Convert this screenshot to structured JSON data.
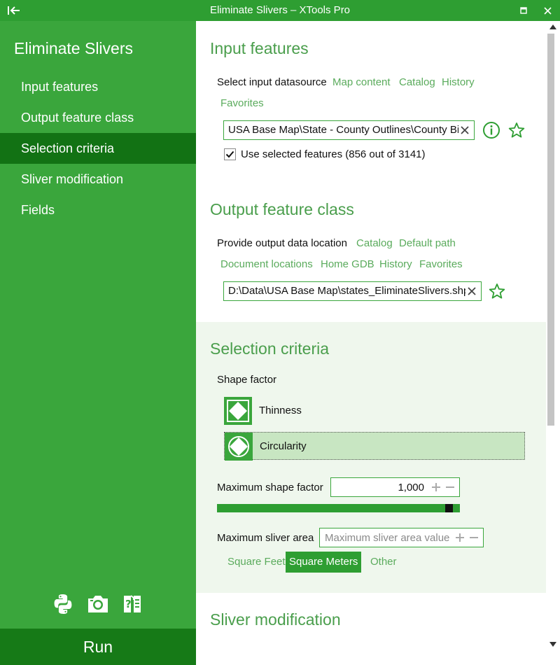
{
  "window": {
    "title": "Eliminate Slivers – XTools Pro",
    "back_icon": "collapse-left-icon",
    "maximize_icon": "maximize-icon",
    "close_icon": "close-icon"
  },
  "colors": {
    "accent": "#2e9e32",
    "sidebar_bg": "#3aa63c",
    "sidebar_active": "#127214",
    "link": "#5aab5c",
    "section_title": "#4a9e4c",
    "selection_band": "#eff7ed",
    "selected_option": "#c8e6c2"
  },
  "sidebar": {
    "title": "Eliminate Slivers",
    "items": [
      {
        "label": "Input features",
        "active": false
      },
      {
        "label": "Output feature class",
        "active": false
      },
      {
        "label": "Selection criteria",
        "active": true
      },
      {
        "label": "Sliver modification",
        "active": false
      },
      {
        "label": "Fields",
        "active": false
      }
    ],
    "tool_icons": [
      "python-icon",
      "camera-icon",
      "help-document-icon"
    ],
    "run_label": "Run"
  },
  "input_features": {
    "title": "Input features",
    "datasource_label": "Select input datasource",
    "links": [
      "Map content",
      "Catalog",
      "History",
      "Favorites"
    ],
    "path_value": "USA Base Map\\State - County Outlines\\County Bi",
    "use_selected_label": "Use selected features (856 out of 3141)",
    "use_selected_checked": true
  },
  "output_feature_class": {
    "title": "Output feature class",
    "location_label": "Provide output data location",
    "links": [
      "Catalog",
      "Default path",
      "Document locations",
      "Home GDB",
      "History",
      "Favorites"
    ],
    "path_value": "D:\\Data\\USA Base Map\\states_EliminateSlivers.shp"
  },
  "selection_criteria": {
    "title": "Selection criteria",
    "shape_factor_label": "Shape factor",
    "options": [
      {
        "label": "Thinness",
        "icon": "thinness-diamond-icon",
        "selected": false
      },
      {
        "label": "Circularity",
        "icon": "circularity-icon",
        "selected": true
      }
    ],
    "max_shape_factor_label": "Maximum shape factor",
    "max_shape_factor_value": "1,000",
    "max_shape_factor_slider_fraction": 0.97,
    "max_sliver_area_label": "Maximum sliver area",
    "max_sliver_area_placeholder": "Maximum sliver area value",
    "units": [
      {
        "label": "Square Feet",
        "selected": false
      },
      {
        "label": "Square Meters",
        "selected": true
      },
      {
        "label": "Other",
        "selected": false
      }
    ]
  },
  "sliver_modification": {
    "title": "Sliver modification"
  }
}
